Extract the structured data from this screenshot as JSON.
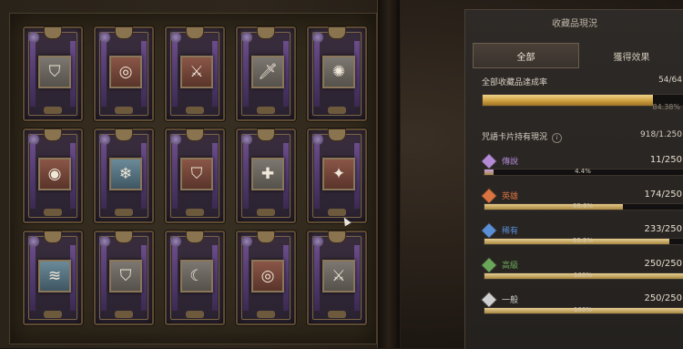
{
  "panel": {
    "title": "收藏品現況",
    "tabs": [
      {
        "label": "全部",
        "active": true
      },
      {
        "label": "獲得效果",
        "active": false
      }
    ],
    "overall": {
      "label": "全部收藏品達成率",
      "value": "54/64",
      "percent_text": "84.38%",
      "fraction": 0.8438
    },
    "cards_owned": {
      "label": "咒語卡片持有現況",
      "value": "918/1.250",
      "icon": "info-icon"
    },
    "rarities": [
      {
        "name": "傳說",
        "count": "11/250",
        "percent_text": "4.4%",
        "fraction": 0.044,
        "color": "#b38ad6",
        "bar": "#c9a3e6"
      },
      {
        "name": "英雄",
        "count": "174/250",
        "percent_text": "69.6%",
        "fraction": 0.696,
        "color": "#d9733f",
        "bar": "#e6c98a"
      },
      {
        "name": "稀有",
        "count": "233/250",
        "percent_text": "93.2%",
        "fraction": 0.932,
        "color": "#5a8ed6",
        "bar": "#e6cf95"
      },
      {
        "name": "高級",
        "count": "250/250",
        "percent_text": "100%",
        "fraction": 1.0,
        "color": "#6aa65a",
        "bar": "#e6cf95"
      },
      {
        "name": "一般",
        "count": "250/250",
        "percent_text": "100%",
        "fraction": 1.0,
        "color": "#cfcfcf",
        "bar": "#e6cf95"
      }
    ]
  },
  "cards": [
    {
      "icon": "shield-icon",
      "glyph": "⛉",
      "tone": "gray"
    },
    {
      "icon": "swirl-icon",
      "glyph": "◎",
      "tone": "red"
    },
    {
      "icon": "crossed-swords-icon",
      "glyph": "⚔",
      "tone": "red"
    },
    {
      "icon": "sword-icon",
      "glyph": "🗡",
      "tone": "gray"
    },
    {
      "icon": "figure-icon",
      "glyph": "✺",
      "tone": "gray"
    },
    {
      "icon": "eye-icon",
      "glyph": "◉",
      "tone": "red"
    },
    {
      "icon": "ice-spike-icon",
      "glyph": "❄",
      "tone": "blue"
    },
    {
      "icon": "shield-icon",
      "glyph": "⛉",
      "tone": "red"
    },
    {
      "icon": "cross-shield-icon",
      "glyph": "✚",
      "tone": "gray"
    },
    {
      "icon": "flexing-figure-icon",
      "glyph": "✦",
      "tone": "red"
    },
    {
      "icon": "wave-icon",
      "glyph": "≋",
      "tone": "blue"
    },
    {
      "icon": "shield-icon",
      "glyph": "⛉",
      "tone": "gray"
    },
    {
      "icon": "crescent-icon",
      "glyph": "☾",
      "tone": "gray"
    },
    {
      "icon": "swirl-icon",
      "glyph": "◎",
      "tone": "red"
    },
    {
      "icon": "crossed-swords-icon",
      "glyph": "⚔",
      "tone": "gray"
    }
  ]
}
